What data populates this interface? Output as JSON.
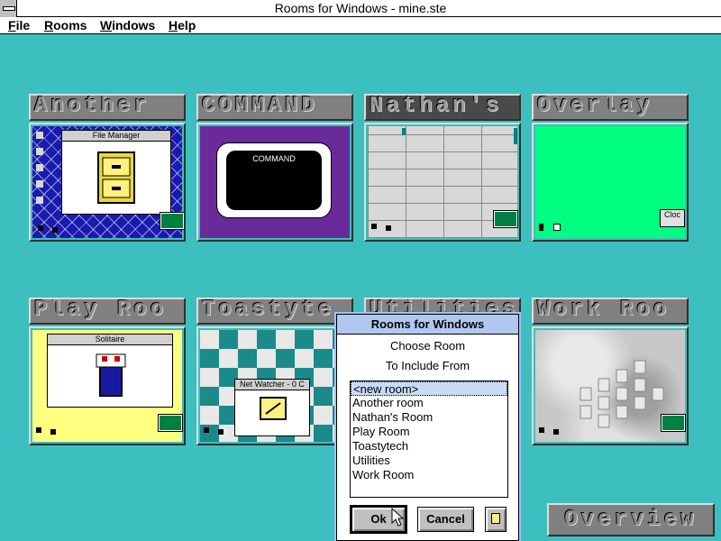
{
  "window": {
    "title": "Rooms for Windows - mine.ste"
  },
  "menu": [
    "File",
    "Rooms",
    "Windows",
    "Help"
  ],
  "rooms": [
    {
      "label": "Another",
      "mini_title": "File Manager"
    },
    {
      "label": "COMMAND",
      "mini_title": "COMMAND"
    },
    {
      "label": "Nathan's"
    },
    {
      "label": "Overlay",
      "mini_title": "Cloc"
    },
    {
      "label": "Play Roo",
      "mini_title": "Solitaire"
    },
    {
      "label": "Toastyte",
      "mini_title": "Net Watcher - 0 C"
    },
    {
      "label": "Utilities"
    },
    {
      "label": "Work Roo"
    }
  ],
  "dialog": {
    "title": "Rooms for Windows",
    "line1": "Choose Room",
    "line2": "To Include From",
    "items": [
      "<new room>",
      "Another room",
      "Nathan's Room",
      "Play Room",
      "Toastytech",
      "Utilities",
      "Work Room"
    ],
    "selected_index": 0,
    "ok_label": "Ok",
    "cancel_label": "Cancel"
  },
  "overview_label": "Overview",
  "colors": {
    "desktop": "#3dbfbf",
    "dialog_title": "#b0c8f0"
  }
}
